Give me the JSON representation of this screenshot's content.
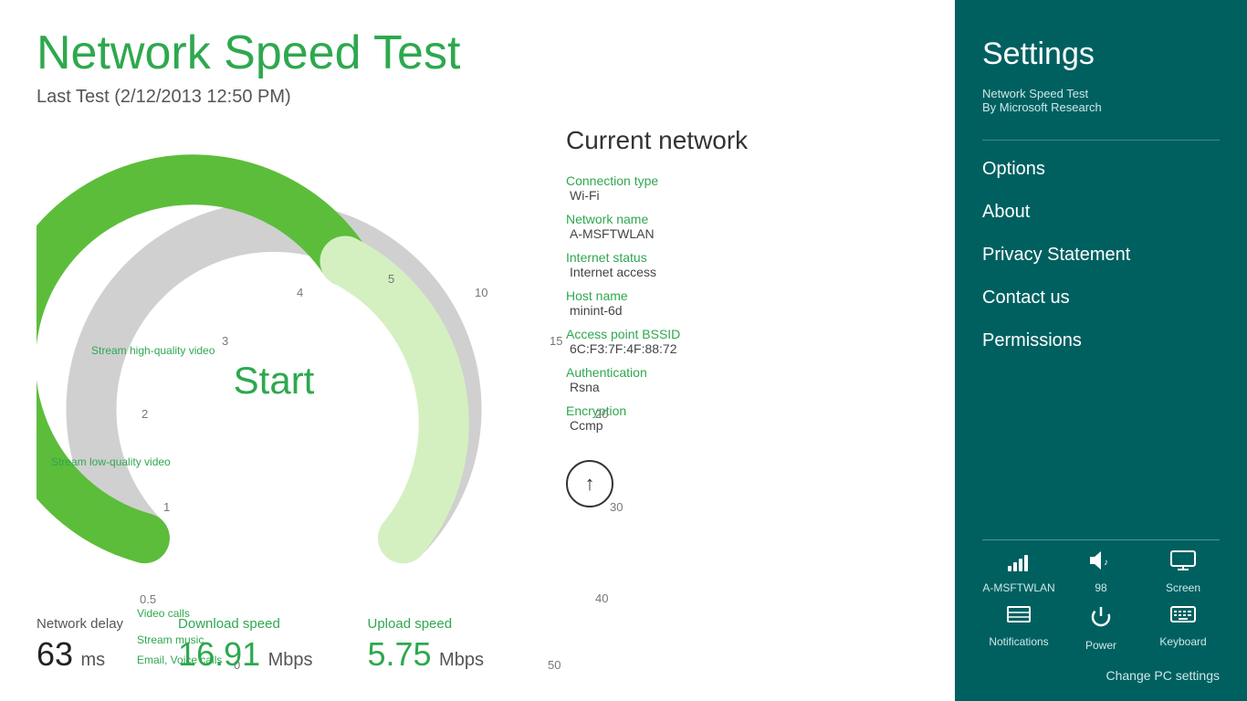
{
  "app": {
    "title": "Network Speed Test",
    "last_test": "Last Test (2/12/2013 12:50 PM)"
  },
  "gauge": {
    "start_label": "Start",
    "scale": [
      "0",
      "0.5",
      "1",
      "2",
      "3",
      "4",
      "5",
      "10",
      "15",
      "20",
      "30",
      "40",
      "50"
    ],
    "activity_labels": {
      "stream_hq": "Stream high-quality video",
      "stream_lq": "Stream low-quality video",
      "video_calls": "Video calls",
      "stream_music": "Stream music",
      "email": "Email, Voice calls"
    }
  },
  "network": {
    "title": "Current network",
    "connection_type_label": "Connection type",
    "connection_type_value": "Wi-Fi",
    "network_name_label": "Network name",
    "network_name_value": "A-MSFTWLAN",
    "internet_status_label": "Internet status",
    "internet_status_value": "Internet access",
    "host_name_label": "Host name",
    "host_name_value": "minint-6d",
    "access_point_label": "Access point BSSID",
    "access_point_value": "6C:F3:7F:4F:88:72",
    "authentication_label": "Authentication",
    "authentication_value": "Rsna",
    "encryption_label": "Encryption",
    "encryption_value": "Ccmp"
  },
  "stats": {
    "network_delay_label": "Network delay",
    "network_delay_value": "63",
    "network_delay_unit": "ms",
    "download_speed_label": "Download speed",
    "download_speed_value": "16.91",
    "download_speed_unit": "Mbps",
    "upload_speed_label": "Upload speed",
    "upload_speed_value": "5.75",
    "upload_speed_unit": "Mbps"
  },
  "settings": {
    "title": "Settings",
    "app_name": "Network Speed Test",
    "app_by": "By Microsoft Research",
    "menu": {
      "options": "Options",
      "about": "About",
      "privacy": "Privacy Statement",
      "contact": "Contact us",
      "permissions": "Permissions"
    },
    "tray": {
      "wifi_label": "A-MSFTWLAN",
      "volume_label": "98",
      "screen_label": "Screen",
      "notifications_label": "Notifications",
      "power_label": "Power",
      "keyboard_label": "Keyboard"
    },
    "change_pc": "Change PC settings"
  }
}
